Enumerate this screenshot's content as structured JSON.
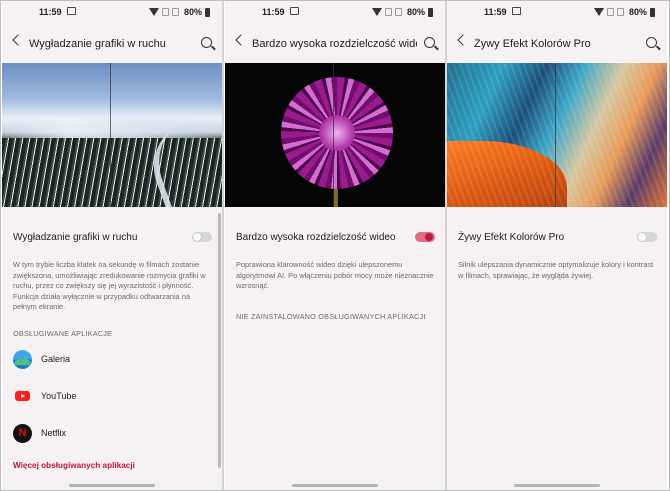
{
  "status_bar": {
    "time": "11:59",
    "battery": "80%"
  },
  "screens": [
    {
      "title": "Wygładzanie grafiki w ruchu",
      "setting_title": "Wygładzanie grafiki w ruchu",
      "toggle_state": "off",
      "description": "W tym trybie liczba klatek na sekundę w filmach zostanie zwiększona, umożliwiając zredukowanie rozmycia grafiki w ruchu, przez co zwiększy się jej wyrazistość i płynność. Funkcja działa wyłącznie w przypadku odtwarzania na pełnym ekranie.",
      "section_label": "OBSŁUGIWANE APLIKACJE",
      "apps": [
        {
          "name": "Galeria",
          "icon": "gallery-icon"
        },
        {
          "name": "YouTube",
          "icon": "youtube-icon"
        },
        {
          "name": "Netflix",
          "icon": "netflix-icon",
          "glyph": "N"
        }
      ],
      "more_link": "Więcej obsługiwanych aplikacji"
    },
    {
      "title": "Bardzo wysoka rozdzielczość wideo",
      "setting_title": "Bardzo wysoka rozdzielczość wideo",
      "toggle_state": "on",
      "description": "Poprawiona klarowność wideo dzięki ulepszonemu algorytmowi AI. Po włączeniu pobór mocy może nieznacznie wzrosnąć.",
      "section_label": "NIE ZAINSTALOWANO OBSŁUGIWANYCH APLIKACJI"
    },
    {
      "title": "Żywy Efekt Kolorów Pro",
      "setting_title": "Żywy Efekt Kolorów Pro",
      "toggle_state": "off",
      "description": "Silnik ulepszania dynamicznie optymalizuje kolory i kontrast w filmach, sprawiając, że wygląda żywiej."
    }
  ],
  "colors": {
    "accent": "#c0163f",
    "toggle_on": "#c01a3e",
    "background": "#f6f2f3"
  }
}
